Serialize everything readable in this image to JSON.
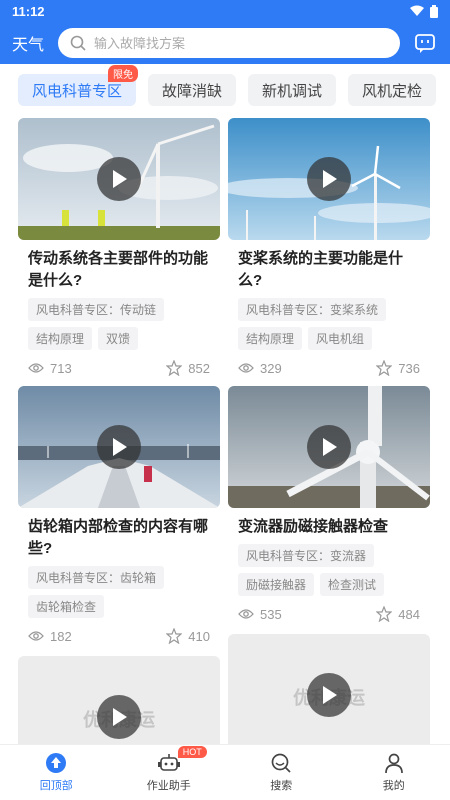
{
  "status_bar": {
    "time": "11:12"
  },
  "header": {
    "weather_label": "天气",
    "search_placeholder": "输入故障找方案"
  },
  "tabs": [
    {
      "label": "风电科普专区",
      "badge": "限免",
      "active": true
    },
    {
      "label": "故障消缺"
    },
    {
      "label": "新机调试"
    },
    {
      "label": "风机定检"
    }
  ],
  "cards": [
    {
      "title": "传动系统各主要部件的功能是什么?",
      "tags": [
        "风电科普专区：传动链",
        "结构原理",
        "双馈"
      ],
      "views": "713",
      "favorites": "852"
    },
    {
      "title": "变桨系统的主要功能是什么?",
      "tags": [
        "风电科普专区：变桨系统",
        "结构原理",
        "风电机组"
      ],
      "views": "329",
      "favorites": "736"
    },
    {
      "title": "齿轮箱内部检查的内容有哪些?",
      "tags": [
        "风电科普专区：齿轮箱",
        "齿轮箱检查"
      ],
      "views": "182",
      "favorites": "410"
    },
    {
      "title": "变流器励磁接触器检查",
      "tags": [
        "风电科普专区：变流器",
        "励磁接触器",
        "检查测试"
      ],
      "views": "535",
      "favorites": "484"
    },
    {
      "watermark": "优利康运"
    },
    {
      "watermark": "优利康运"
    }
  ],
  "bottom_nav": [
    {
      "label": "回顶部",
      "icon": "arrow-up-circle-icon",
      "active": true
    },
    {
      "label": "作业助手",
      "icon": "robot-icon",
      "badge": "HOT"
    },
    {
      "label": "搜索",
      "icon": "search-icon"
    },
    {
      "label": "我的",
      "icon": "person-icon"
    }
  ],
  "colors": {
    "primary": "#2f7bf6",
    "badge": "#ff5a48"
  }
}
